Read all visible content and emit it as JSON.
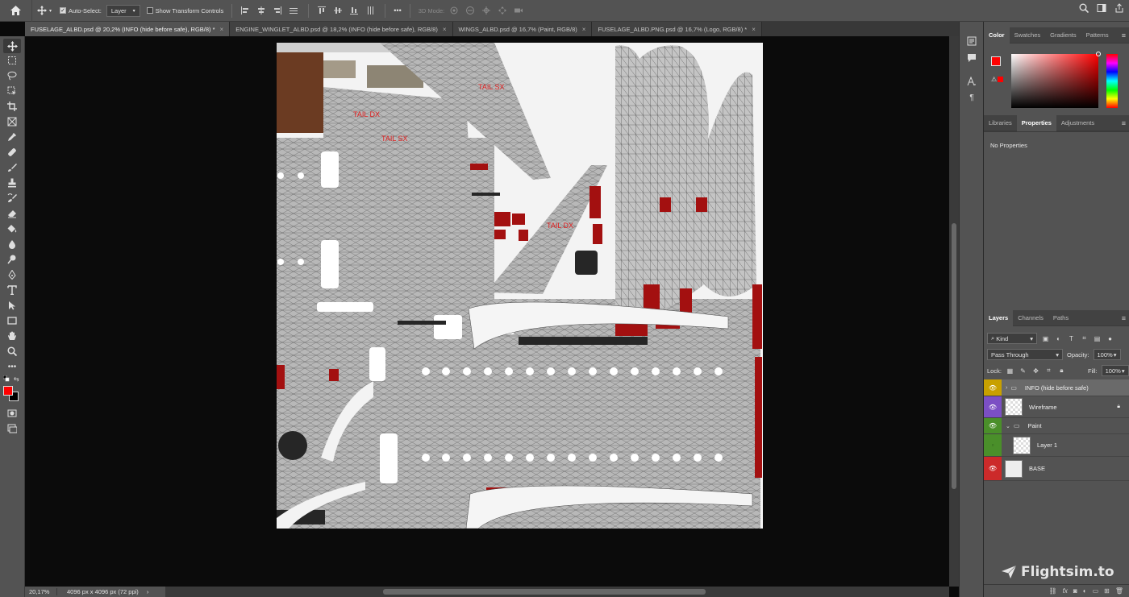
{
  "options_bar": {
    "auto_select_label": "Auto-Select:",
    "auto_select_checked": true,
    "auto_select_target": "Layer",
    "show_transform_label": "Show Transform Controls",
    "show_transform_checked": false,
    "more_label": "•••",
    "mode_3d_label": "3D Mode:"
  },
  "tabs": [
    {
      "label": "FUSELAGE_ALBD.psd @ 20,2% (INFO (hide before safe), RGB/8) *",
      "active": true
    },
    {
      "label": "ENGINE_WINGLET_ALBD.psd @ 18,2% (INFO (hide before safe), RGB/8)",
      "active": false
    },
    {
      "label": "WINGS_ALBD.psd @ 16,7% (Paint, RGB/8)",
      "active": false
    },
    {
      "label": "FUSELAGE_ALBD.PNG.psd @ 16,7% (Logo, RGB/8) *",
      "active": false
    }
  ],
  "tools": [
    "move-tool",
    "marquee-tool",
    "lasso-tool",
    "object-select-tool",
    "crop-tool",
    "frame-tool",
    "eyedropper-tool",
    "healing-brush-tool",
    "brush-tool",
    "clone-stamp-tool",
    "history-brush-tool",
    "eraser-tool",
    "paint-bucket-tool",
    "blur-tool",
    "dodge-tool",
    "pen-tool",
    "type-tool",
    "path-select-tool",
    "rectangle-tool",
    "hand-tool",
    "zoom-tool",
    "more-tools"
  ],
  "canvas": {
    "texture_labels": [
      "TAIL SX",
      "TAIL DX",
      "TAIL SX",
      "TAIL DX"
    ],
    "label_color": "#e02020"
  },
  "status": {
    "zoom": "20,17%",
    "dimensions": "4096 px x 4096 px (72 ppi)",
    "arrow": "›"
  },
  "color_panel": {
    "tabs": [
      "Color",
      "Swatches",
      "Gradients",
      "Patterns"
    ],
    "active": "Color",
    "foreground": "#ff0000",
    "background": "#000000"
  },
  "properties_panel": {
    "tabs": [
      "Libraries",
      "Properties",
      "Adjustments"
    ],
    "active": "Properties",
    "content": "No Properties"
  },
  "layers_panel": {
    "tabs": [
      "Layers",
      "Channels",
      "Paths"
    ],
    "active": "Layers",
    "kind_label": "Kind",
    "blend_mode": "Pass Through",
    "opacity_label": "Opacity:",
    "opacity": "100%",
    "lock_label": "Lock:",
    "fill_label": "Fill:",
    "fill": "100%",
    "layers": [
      {
        "name": "INFO (hide before safe)",
        "kind": "group",
        "color": "#c8a000",
        "visible": true,
        "selected": true
      },
      {
        "name": "Wireframe",
        "kind": "layer",
        "color": "#7b4fc4",
        "visible": true,
        "locked": true
      },
      {
        "name": "Paint",
        "kind": "group",
        "color": "#4a8f2a",
        "visible": true,
        "expanded": true
      },
      {
        "name": "Layer 1",
        "kind": "layer",
        "color": "#4a8f2a",
        "visible": false
      },
      {
        "name": "BASE",
        "kind": "layer",
        "color": "#cc2a2a",
        "visible": true
      }
    ]
  },
  "watermark": "Flightsim.to"
}
